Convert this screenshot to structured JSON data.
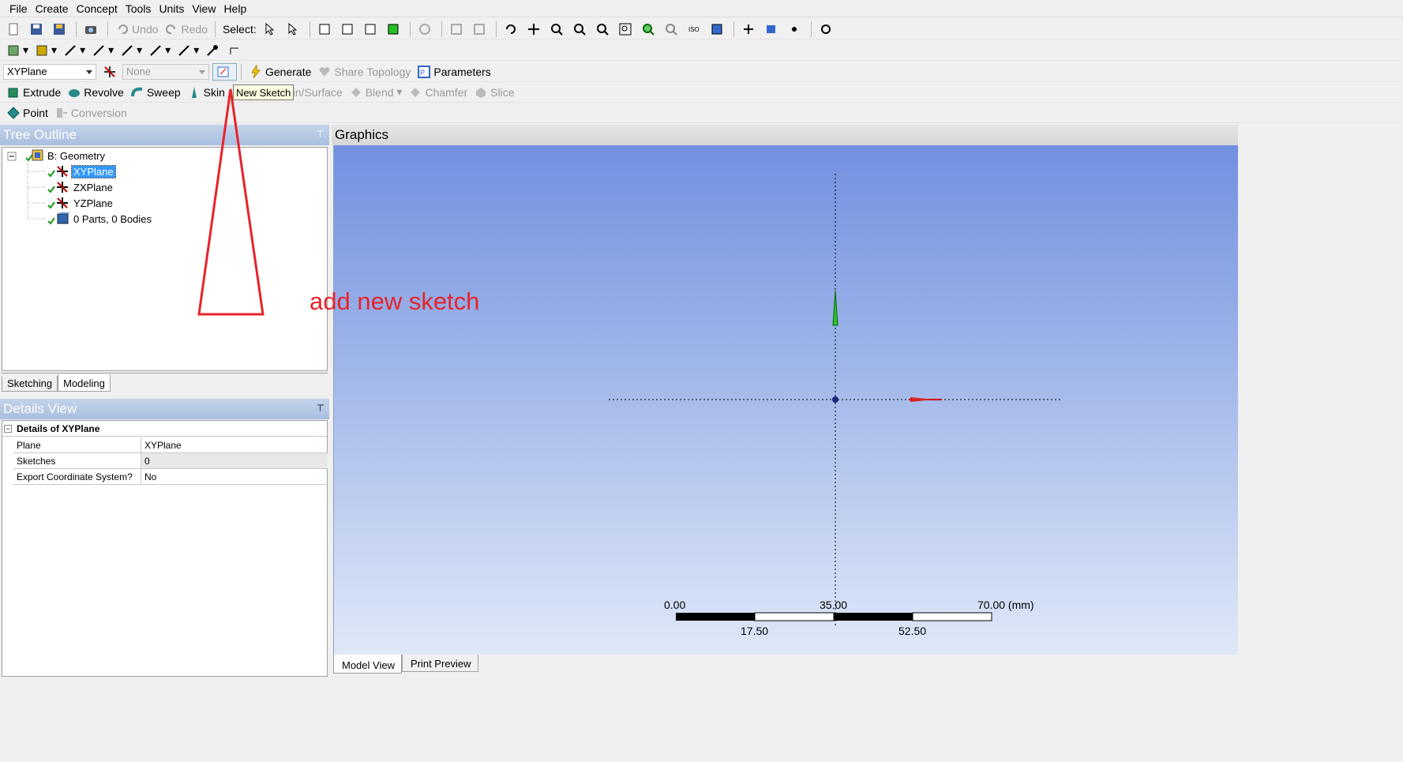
{
  "menu": [
    "File",
    "Create",
    "Concept",
    "Tools",
    "Units",
    "View",
    "Help"
  ],
  "toolbar1": {
    "undo": "Undo",
    "redo": "Redo",
    "select": "Select:"
  },
  "toolbar3": {
    "plane_combo": "XYPlane",
    "sketch_combo": "None",
    "generate": "Generate",
    "share_topology": "Share Topology",
    "parameters": "Parameters"
  },
  "toolbar4": {
    "extrude": "Extrude",
    "revolve": "Revolve",
    "sweep": "Sweep",
    "skin": "Skin",
    "thin_surface": "hin/Surface",
    "blend": "Blend",
    "chamfer": "Chamfer",
    "slice": "Slice"
  },
  "toolbar5": {
    "point": "Point",
    "conversion": "Conversion"
  },
  "tooltip": "New Sketch",
  "annotation": "add new sketch",
  "tree": {
    "title": "Tree Outline",
    "root": "B: Geometry",
    "items": [
      "XYPlane",
      "ZXPlane",
      "YZPlane",
      "0 Parts, 0 Bodies"
    ]
  },
  "tabs": [
    "Sketching",
    "Modeling"
  ],
  "details": {
    "title": "Details View",
    "header": "Details of XYPlane",
    "rows": [
      {
        "k": "Plane",
        "v": "XYPlane"
      },
      {
        "k": "Sketches",
        "v": "0"
      },
      {
        "k": "Export Coordinate System?",
        "v": "No"
      }
    ]
  },
  "graphics": {
    "title": "Graphics",
    "scale_top": [
      "0.00",
      "35.00",
      "70.00 (mm)"
    ],
    "scale_bottom": [
      "17.50",
      "52.50"
    ]
  },
  "bottom_tabs": [
    "Model View",
    "Print Preview"
  ],
  "colors": {
    "accent": "#e8232b",
    "panel_header": "#a9bfdf",
    "selection": "#3399ff"
  }
}
